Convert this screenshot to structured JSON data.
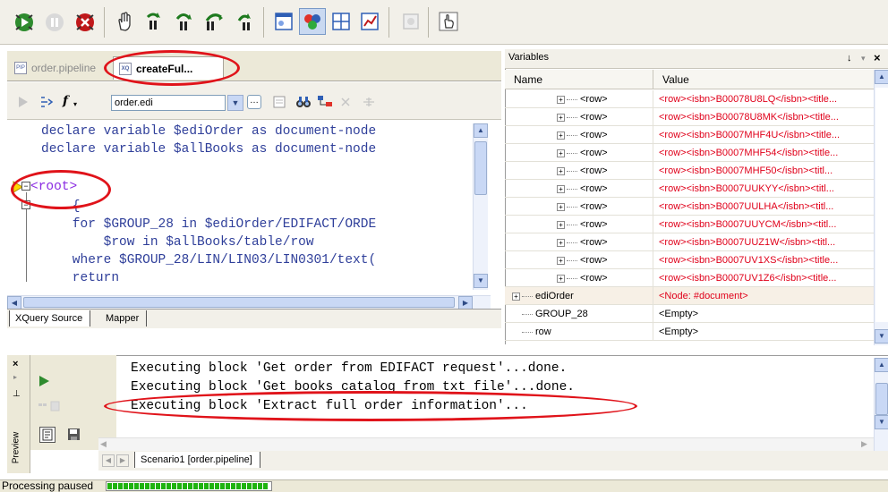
{
  "toolbar": {
    "buttons": [
      {
        "name": "run-icon",
        "color": "#2e8b2e"
      },
      {
        "name": "pause-icon",
        "color": "#bdbdbd"
      },
      {
        "name": "stop-icon",
        "color": "#c0181a"
      },
      {
        "name": "hand-icon",
        "color": "#333333"
      },
      {
        "name": "step-into-icon",
        "color": "#1e7a1e"
      },
      {
        "name": "step-over-icon",
        "color": "#1e7a1e"
      },
      {
        "name": "step-out-icon",
        "color": "#1e7a1e"
      },
      {
        "name": "run-to-cursor-icon",
        "color": "#1e7a1e"
      },
      {
        "name": "window-icon",
        "color": "#2f5fb5"
      },
      {
        "name": "palette-icon",
        "color": "#2f5fb5"
      },
      {
        "name": "layout-icon",
        "color": "#2f5fb5"
      },
      {
        "name": "chart-icon",
        "color": "#2f5fb5"
      },
      {
        "name": "disabled-icon",
        "color": "#bdbdbd"
      },
      {
        "name": "pointer-icon",
        "color": "#333333"
      }
    ]
  },
  "editor": {
    "tabs": [
      {
        "label": "order.pipeline",
        "active": false
      },
      {
        "label": "createFul...",
        "active": true
      }
    ],
    "function_label": "f",
    "file_combo": "order.edi",
    "lines": [
      "declare variable $ediOrder as document-node",
      "declare variable $allBooks as document-node",
      "",
      "<root>",
      "    {",
      "    for $GROUP_28 in $ediOrder/EDIFACT/ORDE",
      "        $row in $allBooks/table/row",
      "    where $GROUP_28/LIN/LIN03/LIN0301/text(",
      "    return"
    ],
    "bottom_tabs": [
      "XQuery Source",
      "Mapper"
    ]
  },
  "variables": {
    "title": "Variables",
    "pin_glyph": "↓",
    "close_glyph": "×",
    "columns": [
      "Name",
      "Value"
    ],
    "rows": [
      {
        "name": "<row>",
        "value": "<row><isbn>B00078U8LQ</isbn><title...",
        "expandable": true,
        "indent": 2,
        "red": true
      },
      {
        "name": "<row>",
        "value": "<row><isbn>B00078U8MK</isbn><title...",
        "expandable": true,
        "indent": 2,
        "red": true
      },
      {
        "name": "<row>",
        "value": "<row><isbn>B0007MHF4U</isbn><title...",
        "expandable": true,
        "indent": 2,
        "red": true
      },
      {
        "name": "<row>",
        "value": "<row><isbn>B0007MHF54</isbn><title...",
        "expandable": true,
        "indent": 2,
        "red": true
      },
      {
        "name": "<row>",
        "value": "<row><isbn>B0007MHF50</isbn><titl...",
        "expandable": true,
        "indent": 2,
        "red": true
      },
      {
        "name": "<row>",
        "value": "<row><isbn>B0007UUKYY</isbn><titl...",
        "expandable": true,
        "indent": 2,
        "red": true
      },
      {
        "name": "<row>",
        "value": "<row><isbn>B0007UULHA</isbn><titl...",
        "expandable": true,
        "indent": 2,
        "red": true
      },
      {
        "name": "<row>",
        "value": "<row><isbn>B0007UUYCM</isbn><titl...",
        "expandable": true,
        "indent": 2,
        "red": true
      },
      {
        "name": "<row>",
        "value": "<row><isbn>B0007UUZ1W</isbn><titl...",
        "expandable": true,
        "indent": 2,
        "red": true
      },
      {
        "name": "<row>",
        "value": "<row><isbn>B0007UV1XS</isbn><title...",
        "expandable": true,
        "indent": 2,
        "red": true
      },
      {
        "name": "<row>",
        "value": "<row><isbn>B0007UV1Z6</isbn><title...",
        "expandable": true,
        "indent": 2,
        "red": true
      },
      {
        "name": "ediOrder",
        "value": "<Node: #document>",
        "expandable": true,
        "indent": 0,
        "red": true
      },
      {
        "name": "GROUP_28",
        "value": "<Empty>",
        "expandable": false,
        "indent": 0,
        "red": false
      },
      {
        "name": "row",
        "value": "<Empty>",
        "expandable": false,
        "indent": 0,
        "red": false
      }
    ]
  },
  "output": {
    "side_label": "Preview",
    "lines": [
      "Executing block 'Get order from EDIFACT request'...done.",
      "Executing block 'Get books catalog from txt file'...done.",
      "Executing block 'Extract full order information'..."
    ],
    "tab": "Scenario1 [order.pipeline]"
  },
  "status": {
    "text": "Processing paused",
    "progress": 1.0,
    "bar_color": "#1fb30f"
  },
  "highlight_color": "#e0131a"
}
